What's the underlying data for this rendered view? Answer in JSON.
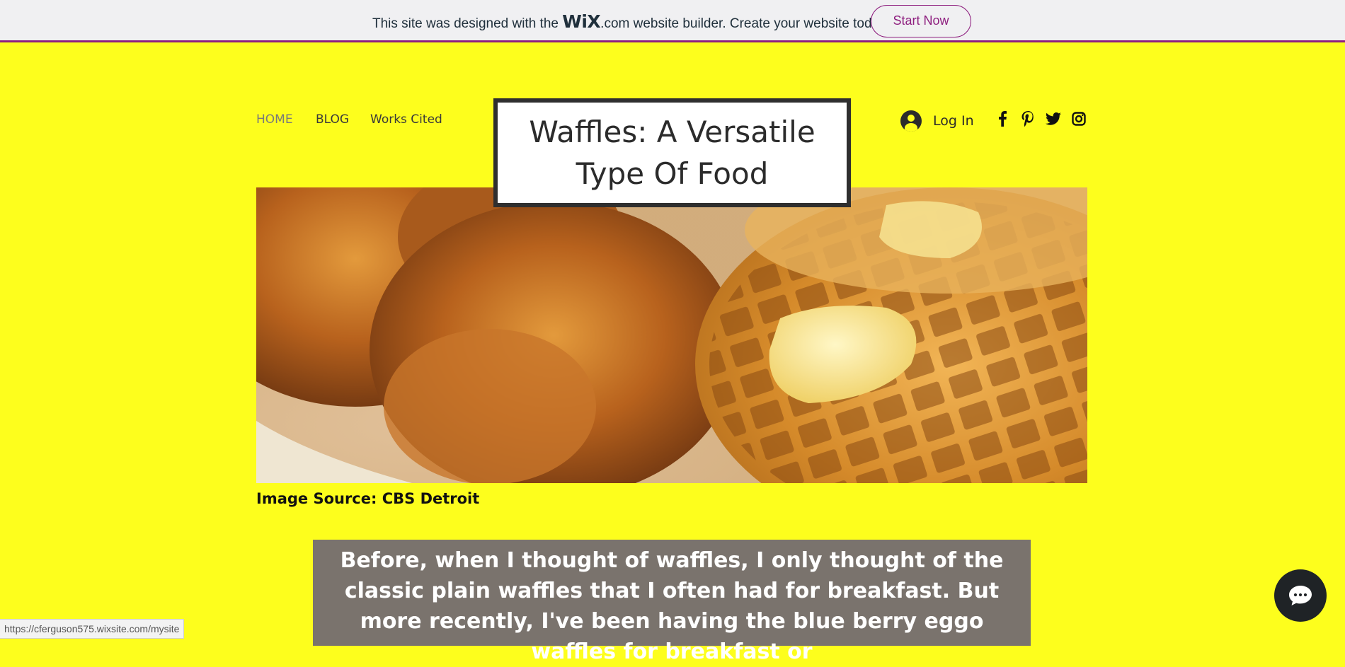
{
  "wix_banner": {
    "text_before": "This site was designed with the ",
    "logo_wix": "WiX",
    "logo_com": ".com",
    "text_after": " website builder. Create your website today.",
    "button_label": "Start Now"
  },
  "nav": {
    "items": [
      {
        "label": "HOME"
      },
      {
        "label": "BLOG"
      },
      {
        "label": "Works Cited"
      }
    ]
  },
  "title": "Waffles: A Versatile Type Of Food",
  "login": {
    "label": "Log In"
  },
  "social": [
    "facebook-icon",
    "pinterest-icon",
    "twitter-icon",
    "instagram-icon"
  ],
  "hero": {
    "caption": "Image Source: CBS Detroit"
  },
  "intro_paragraph": "Before, when I thought of waffles, I only thought of the classic plain waffles that I often had for breakfast. But more recently, I've been having the blue berry eggo waffles for breakfast or",
  "status_bar": {
    "url": "https://cferguson575.wixsite.com/mysite"
  },
  "colors": {
    "page_bg": "#FDFE1D",
    "banner_accent": "#8E1F7F",
    "paragraph_bg": "#7A736D"
  }
}
